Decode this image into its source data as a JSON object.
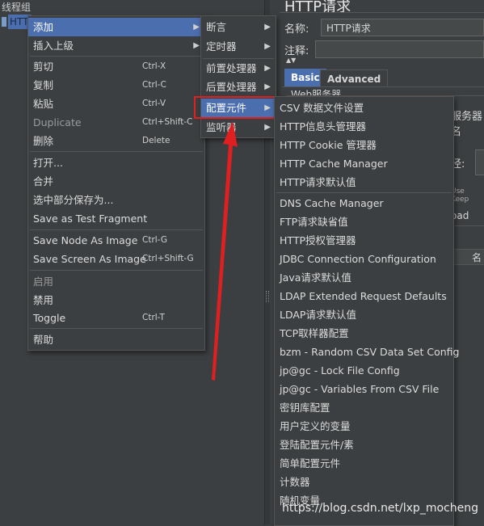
{
  "tree": {
    "root": "线程组",
    "selected": "HTT"
  },
  "right_panel": {
    "title": "HTTP请求",
    "name_label": "名称:",
    "name_value": "HTTP请求",
    "comment_label": "注释:",
    "tabs": [
      "Basic",
      "Advanced"
    ],
    "web_server_label": "Web服务器",
    "server_label": "服务器名",
    "path_label": "径:",
    "keep_label": "Use Keep",
    "upload_label": "oad",
    "col_label": "名"
  },
  "context_menu": {
    "items": [
      {
        "label": "添加",
        "arrow": true,
        "selected": true
      },
      {
        "label": "插入上级",
        "arrow": true
      },
      {
        "label": "剪切",
        "shortcut": "Ctrl-X"
      },
      {
        "label": "复制",
        "shortcut": "Ctrl-C"
      },
      {
        "label": "粘贴",
        "shortcut": "Ctrl-V"
      },
      {
        "label": "Duplicate",
        "shortcut": "Ctrl+Shift-C",
        "dim": true
      },
      {
        "label": "删除",
        "shortcut": "Delete"
      },
      {
        "label": "打开..."
      },
      {
        "label": "合并"
      },
      {
        "label": "选中部分保存为..."
      },
      {
        "label": "Save as Test Fragment"
      },
      {
        "label": "Save Node As Image",
        "shortcut": "Ctrl-G"
      },
      {
        "label": "Save Screen As Image",
        "shortcut": "Ctrl+Shift-G"
      },
      {
        "label": "启用",
        "dim": true
      },
      {
        "label": "禁用"
      },
      {
        "label": "Toggle",
        "shortcut": "Ctrl-T"
      },
      {
        "label": "帮助"
      }
    ]
  },
  "submenu": {
    "items": [
      {
        "label": "断言",
        "arrow": true
      },
      {
        "label": "定时器",
        "arrow": true
      },
      {
        "label": "前置处理器",
        "arrow": true
      },
      {
        "label": "后置处理器",
        "arrow": true
      },
      {
        "label": "配置元件",
        "arrow": true,
        "selected": true
      },
      {
        "label": "监听器",
        "arrow": true
      }
    ]
  },
  "config_menu": {
    "items": [
      "CSV 数据文件设置",
      "HTTP信息头管理器",
      "HTTP Cookie 管理器",
      "HTTP Cache Manager",
      "HTTP请求默认值",
      "DNS Cache Manager",
      "FTP请求缺省值",
      "HTTP授权管理器",
      "JDBC Connection Configuration",
      "Java请求默认值",
      "LDAP Extended Request Defaults",
      "LDAP请求默认值",
      "TCP取样器配置",
      "bzm - Random CSV Data Set Config",
      "jp@gc - Lock File Config",
      "jp@gc - Variables From CSV File",
      "密钥库配置",
      "用户定义的变量",
      "登陆配置元件/素",
      "简单配置元件",
      "计数器",
      "随机变量"
    ]
  },
  "colors": {
    "highlight": "#4b6eaf",
    "annotation_red": "#e02020",
    "background": "#3c3f41"
  },
  "watermark": "https://blog.csdn.net/lxp_mocheng"
}
